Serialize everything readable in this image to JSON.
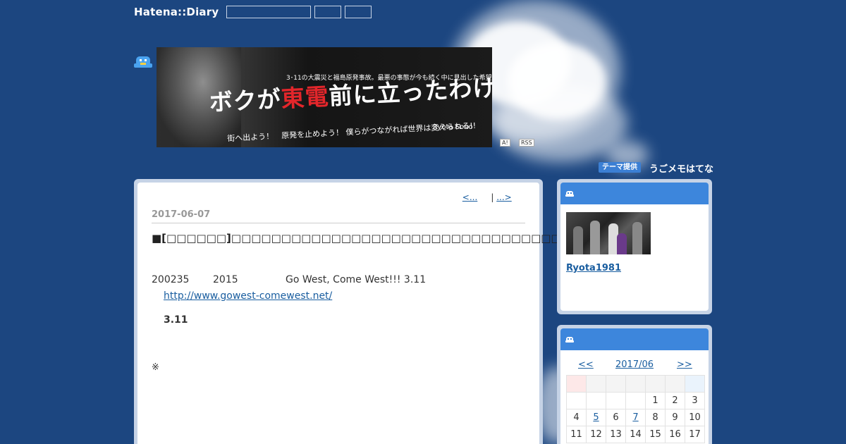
{
  "topbar": {
    "logo": "Hatena::Diary"
  },
  "banner": {
    "subtitle": "3･11の大震災と福島原発事故。最悪の事態が今も続く中に見出した希望",
    "title_pre": "ボクが",
    "title_red": "東電",
    "title_post": "前に立ったわけ",
    "tagline": "街へ出よう！　原発を止めよう！ 僕らがつながれば世界は変えられる!!",
    "author": "Ryota Sono"
  },
  "badges": {
    "a_label": "A!",
    "rss_label": "RSS"
  },
  "theme": {
    "badge": "テーマ提供",
    "name": "うごメモはてな"
  },
  "pager": {
    "prev": "<...",
    "sep": "|",
    "next": "...>"
  },
  "entry": {
    "date": "2017-06-07",
    "title": "■[□□□□□□]□□□□□□□□□□□□□□□□□□□□□□□□□□□□□□□□□□□□□□",
    "star": "★",
    "line1_a": "200235",
    "line1_b": "2015",
    "line1_c": "Go West, Come West!!! 3.11",
    "link": "http://www.gowest-comewest.net/",
    "strong": "3.11",
    "note": "※"
  },
  "profile": {
    "name": "Ryota1981"
  },
  "calendar": {
    "prev": "<<",
    "month": "2017/06",
    "next": ">>",
    "weeks": [
      [
        "",
        "",
        "",
        "",
        "1",
        "2",
        "3"
      ],
      [
        "4",
        "5",
        "6",
        "7",
        "8",
        "9",
        "10"
      ],
      [
        "11",
        "12",
        "13",
        "14",
        "15",
        "16",
        "17"
      ]
    ],
    "linked_days": [
      "5",
      "7"
    ]
  },
  "colors": {
    "background": "#1c4680",
    "panel_frame": "#c6d3e6",
    "sidebar_header": "#3d86dc",
    "link": "#1a5ea0"
  }
}
